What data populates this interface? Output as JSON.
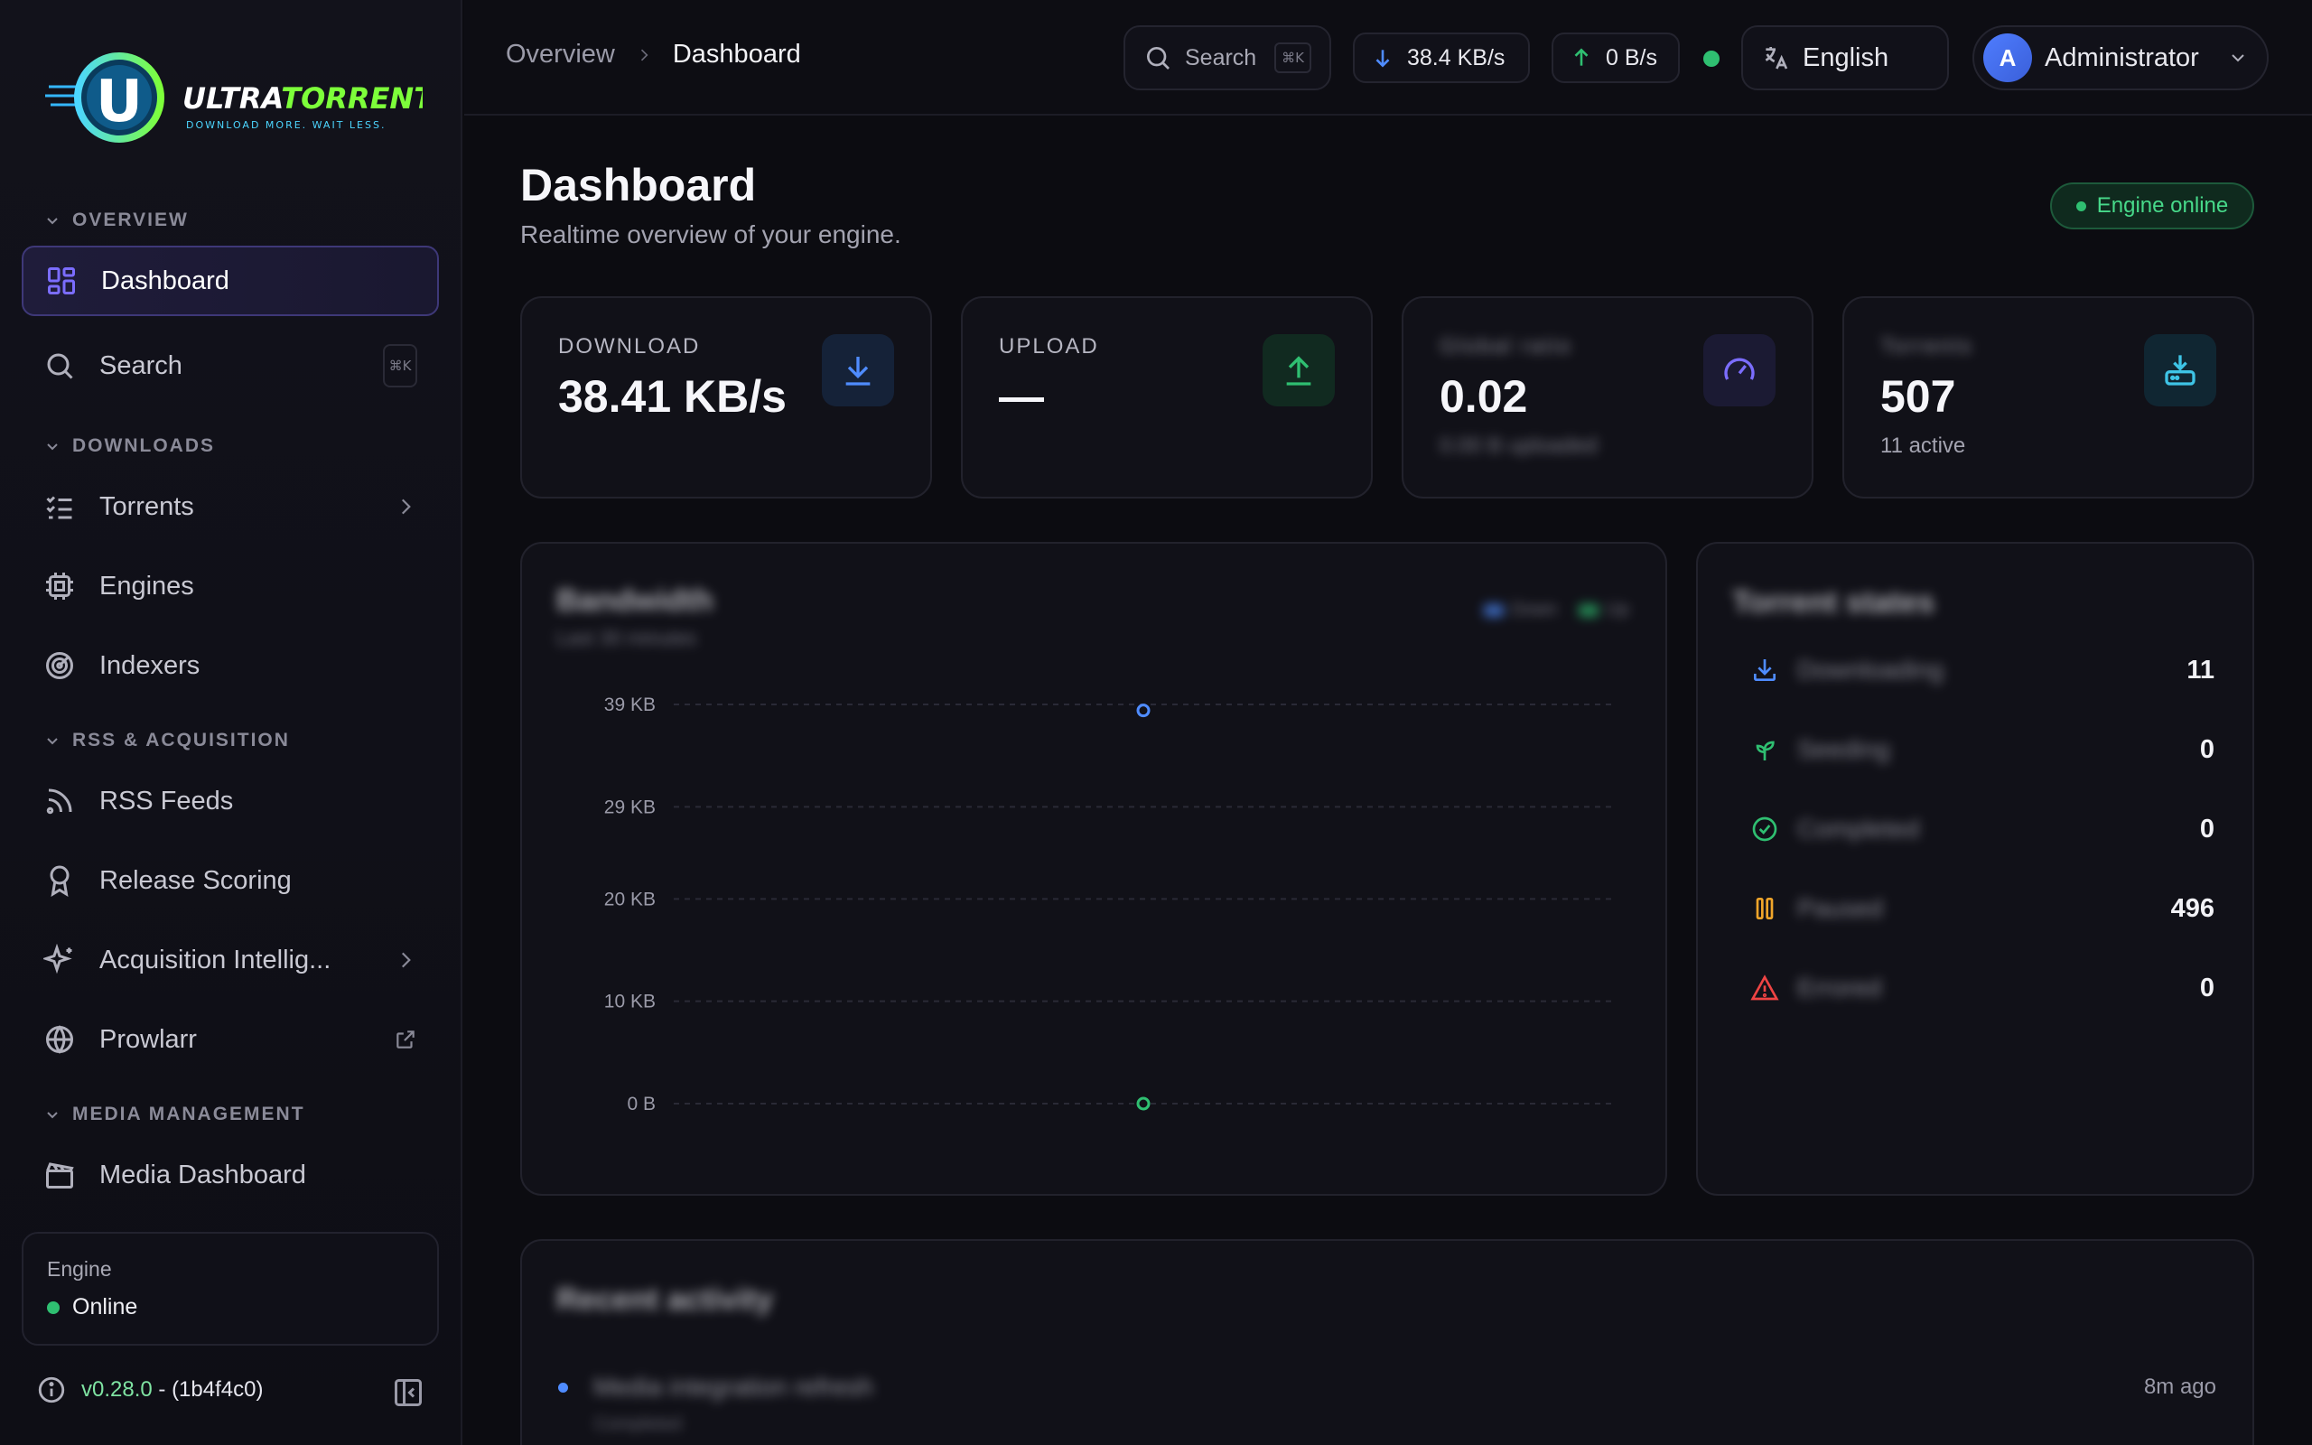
{
  "brand": {
    "name": "ULTRATORRENT",
    "tagline": "DOWNLOAD MORE. WAIT LESS."
  },
  "sidebar": {
    "sections": {
      "overview": "OVERVIEW",
      "downloads": "DOWNLOADS",
      "rss": "RSS & ACQUISITION",
      "media": "MEDIA MANAGEMENT"
    },
    "items": {
      "dashboard": "Dashboard",
      "search": "Search",
      "search_shortcut": "⌘K",
      "torrents": "Torrents",
      "engines": "Engines",
      "indexers": "Indexers",
      "rss_feeds": "RSS Feeds",
      "release_scoring": "Release Scoring",
      "acquisition": "Acquisition Intellig...",
      "prowlarr": "Prowlarr",
      "media_dashboard": "Media Dashboard"
    },
    "engine": {
      "label": "Engine",
      "status": "Online",
      "status_color": "#2fbf71"
    },
    "version": {
      "number": "v0.28.0",
      "separator": " - ",
      "hash": "(1b4f4c0)"
    }
  },
  "topbar": {
    "breadcrumb": [
      "Overview",
      "Dashboard"
    ],
    "search_label": "Search",
    "search_shortcut": "⌘K",
    "down_speed": "38.4 KB/s",
    "up_speed": "0 B/s",
    "language": "English",
    "user_initial": "A",
    "user_name": "Administrator"
  },
  "main": {
    "title": "Dashboard",
    "subtitle": "Realtime overview of your engine.",
    "engine_badge": "Engine online",
    "stats": {
      "download": {
        "label": "DOWNLOAD",
        "value": "38.41 KB/s"
      },
      "upload": {
        "label": "UPLOAD",
        "value": "—"
      },
      "ratio": {
        "label": "Global ratio",
        "value": "0.02",
        "sub": "0.00 B uploaded"
      },
      "torrents": {
        "label": "Torrents",
        "value": "507",
        "sub": "11 active"
      }
    },
    "chart": {
      "title": "Bandwidth",
      "subtitle": "Last 30 minutes"
    },
    "torrent_status": {
      "title": "Torrent states",
      "rows": [
        {
          "label": "Downloading",
          "count": "11",
          "icon": "download-icon",
          "color": "#4f8cff"
        },
        {
          "label": "Seeding",
          "count": "0",
          "icon": "sprout-icon",
          "color": "#2fbf71"
        },
        {
          "label": "Completed",
          "count": "0",
          "icon": "check-circle-icon",
          "color": "#2fbf71"
        },
        {
          "label": "Paused",
          "count": "496",
          "icon": "pause-icon",
          "color": "#f0a52a"
        },
        {
          "label": "Errored",
          "count": "0",
          "icon": "alert-triangle-icon",
          "color": "#ef4444"
        }
      ]
    },
    "activity": {
      "title": "Recent activity",
      "item_title": "Media integration refresh",
      "item_sub": "Completed",
      "item_time": "8m ago"
    }
  },
  "chart_data": {
    "type": "scatter",
    "title": "Bandwidth",
    "subtitle": "Last 30 minutes",
    "ytick_labels": [
      "0 B",
      "10 KB",
      "20 KB",
      "29 KB",
      "39 KB"
    ],
    "yticks": [
      0,
      10,
      20,
      29,
      39
    ],
    "ylim": [
      0,
      39
    ],
    "x_label": "",
    "series": [
      {
        "name": "Down",
        "color": "#4f8cff",
        "values": [
          38.41
        ]
      },
      {
        "name": "Up",
        "color": "#2fbf71",
        "values": [
          0
        ]
      }
    ],
    "grid": true,
    "legend": "top-right"
  },
  "colors": {
    "accent": "#6b5cff",
    "download": "#4f8cff",
    "upload": "#2fbf71",
    "online": "#2fbf71"
  }
}
